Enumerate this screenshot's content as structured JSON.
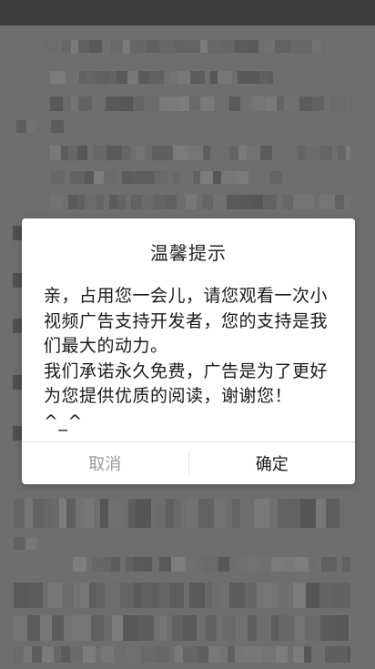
{
  "dialog": {
    "title": "温馨提示",
    "message_lines": [
      "亲，占用您一会儿，请您观看一次小视频广告支持开发者，您的支持是我们最大的动力。",
      "我们承诺永久免费，广告是为了更好为您提供优质的阅读，谢谢您！ ^_^"
    ],
    "cancel_label": "取消",
    "confirm_label": "确定"
  }
}
